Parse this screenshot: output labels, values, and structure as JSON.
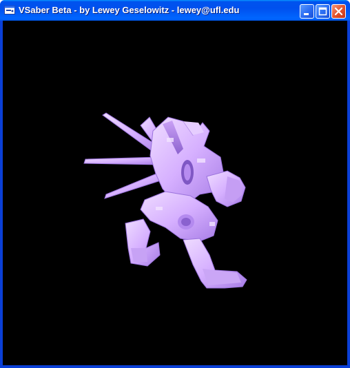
{
  "window": {
    "title": "VSaber Beta - by Lewey Geselowitz - lewey@ufl.edu",
    "icon": "app-window-icon",
    "buttons": {
      "minimize": "minimize-icon",
      "maximize": "maximize-icon",
      "close": "close-icon"
    }
  },
  "viewport": {
    "background": "#000000",
    "model_color": "#d9b4ff",
    "content": "3d-voxel-robot-render"
  },
  "colors": {
    "titlebar": "#0058ee",
    "close_button": "#e2512a"
  }
}
